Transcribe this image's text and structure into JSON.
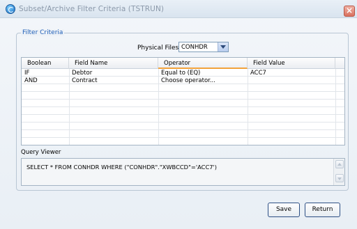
{
  "window": {
    "title": "Subset/Archive Filter Criteria (TSTRUN)",
    "close_label": "×"
  },
  "filter": {
    "group_title": "Filter Criteria",
    "physical_files_label": "Physical Files",
    "physical_files_value": "CONHDR"
  },
  "grid": {
    "columns": [
      "Boolean",
      "Field Name",
      "Operator",
      "Field Value"
    ],
    "rows": [
      {
        "boolean": "IF",
        "field_name": "Debtor",
        "operator": "Equal to (EQ)",
        "field_value": "ACC7"
      },
      {
        "boolean": "AND",
        "field_name": "Contract",
        "operator": "Choose operator...",
        "field_value": ""
      }
    ]
  },
  "query_viewer": {
    "label": "Query Viewer",
    "sql": "SELECT * FROM CONHDR WHERE (\"CONHDR\".\"XWBCCD\"='ACC7')"
  },
  "buttons": {
    "save": "Save",
    "return": "Return"
  }
}
